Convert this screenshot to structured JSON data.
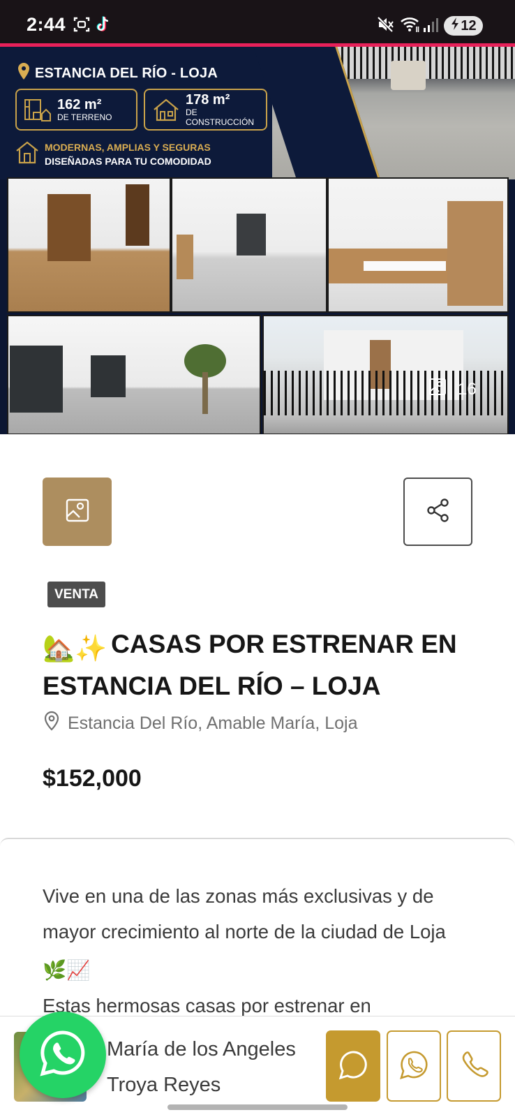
{
  "status_bar": {
    "time": "2:44",
    "battery": "12",
    "icons": [
      "screenshot-icon",
      "tiktok-icon",
      "mute-icon",
      "wifi-icon",
      "signal-icon",
      "battery-charging-icon"
    ]
  },
  "hero": {
    "banner": {
      "location": "ESTANCIA DEL RÍO - LOJA",
      "land_value": "162 m²",
      "land_label": "DE TERRENO",
      "build_value": "178 m²",
      "build_label": "DE CONSTRUCCIÓN",
      "feature_line1": "MODERNAS, AMPLIAS Y SEGURAS",
      "feature_line2": "DISEÑADAS PARA TU COMODIDAD"
    },
    "photo_count": "16"
  },
  "listing": {
    "badge": "VENTA",
    "title_emojis": "🏡✨",
    "title": "CASAS POR ESTRENAR EN ESTANCIA DEL RÍO – LOJA",
    "address": "Estancia Del Río, Amable María, Loja",
    "price": "$152,000",
    "description_line1": "Vive en una de las zonas más exclusivas y de mayor crecimiento al norte de la ciudad de Loja",
    "description_emojis": "🌿📈",
    "description_line2": "Estas hermosas casas por estrenar en"
  },
  "agent": {
    "name": "María de los Angeles Troya Reyes"
  },
  "colors": {
    "gold": "#c59a2f",
    "tan": "#ad8e5f",
    "navy": "#0d1a3a",
    "whatsapp": "#25d366",
    "accent_pink": "#e8215a"
  }
}
